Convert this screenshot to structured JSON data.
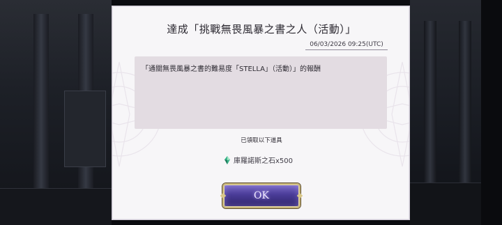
{
  "dialog": {
    "title": "達成「挑戰無畏風暴之書之人（活動）」",
    "timestamp": "06/03/2026 09:25(UTC)",
    "message": "「通關無畏風暴之書的難易度「STELLA」（活動）」的報酬",
    "received_label": "已領取以下道具",
    "reward": {
      "icon": "lacrimosa-stone-icon",
      "label": "庫羅諾斯之石x500"
    },
    "ok_label": "OK"
  },
  "colors": {
    "dialog_bg": "#f7f6f8",
    "message_bg": "#e3dce2",
    "button_purple": "#4a3c98",
    "button_gold": "#c9b77a"
  }
}
